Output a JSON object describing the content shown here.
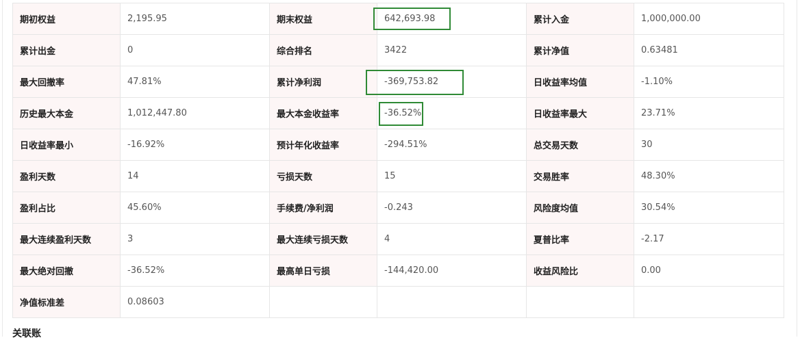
{
  "stats": {
    "rows": [
      [
        {
          "label": "期初权益",
          "value": "2,195.95"
        },
        {
          "label": "期末权益",
          "value": "642,693.98"
        },
        {
          "label": "累计入金",
          "value": "1,000,000.00"
        }
      ],
      [
        {
          "label": "累计出金",
          "value": "0"
        },
        {
          "label": "综合排名",
          "value": "3422"
        },
        {
          "label": "累计净值",
          "value": "0.63481"
        }
      ],
      [
        {
          "label": "最大回撤率",
          "value": "47.81%"
        },
        {
          "label": "累计净利润",
          "value": "-369,753.82"
        },
        {
          "label": "日收益率均值",
          "value": "-1.10%"
        }
      ],
      [
        {
          "label": "历史最大本金",
          "value": "1,012,447.80"
        },
        {
          "label": "最大本金收益率",
          "value": "-36.52%"
        },
        {
          "label": "日收益率最大",
          "value": "23.71%"
        }
      ],
      [
        {
          "label": "日收益率最小",
          "value": "-16.92%"
        },
        {
          "label": "预计年化收益率",
          "value": "-294.51%"
        },
        {
          "label": "总交易天数",
          "value": "30"
        }
      ],
      [
        {
          "label": "盈利天数",
          "value": "14"
        },
        {
          "label": "亏损天数",
          "value": "15"
        },
        {
          "label": "交易胜率",
          "value": "48.30%"
        }
      ],
      [
        {
          "label": "盈利占比",
          "value": "45.60%"
        },
        {
          "label": "手续费/净利润",
          "value": "-0.243"
        },
        {
          "label": "风险度均值",
          "value": "30.54%"
        }
      ],
      [
        {
          "label": "最大连续盈利天数",
          "value": "3"
        },
        {
          "label": "最大连续亏损天数",
          "value": "4"
        },
        {
          "label": "夏普比率",
          "value": "-2.17"
        }
      ],
      [
        {
          "label": "最大绝对回撤",
          "value": "-36.52%"
        },
        {
          "label": "最高单日亏损",
          "value": "-144,420.00"
        },
        {
          "label": "收益风险比",
          "value": "0.00"
        }
      ],
      [
        {
          "label": "净值标准差",
          "value": "0.08603"
        }
      ]
    ]
  },
  "highlight_color": "#2f8a35",
  "footer": {
    "text": "关联账"
  }
}
